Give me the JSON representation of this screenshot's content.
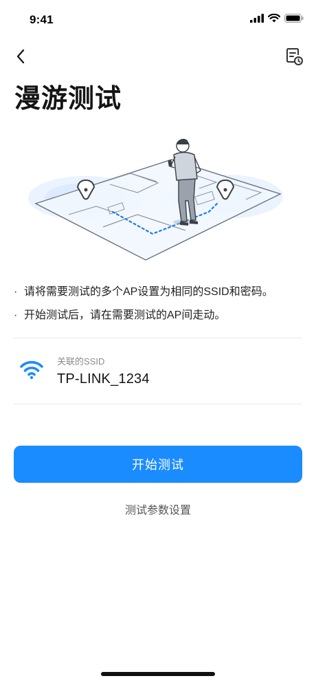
{
  "status_bar": {
    "time": "9:41"
  },
  "nav": {
    "back_icon": "chevron-left-icon",
    "history_icon": "document-clock-icon"
  },
  "page": {
    "title": "漫游测试"
  },
  "tips": [
    {
      "bullet": "·",
      "text": "请将需要测试的多个AP设置为相同的SSID和密码。"
    },
    {
      "bullet": "·",
      "text": "开始测试后，请在需要测试的AP间走动。"
    }
  ],
  "ssid": {
    "label": "关联的SSID",
    "value": "TP-LINK_1234",
    "icon": "wifi-icon"
  },
  "actions": {
    "start_label": "开始测试",
    "settings_label": "测试参数设置"
  },
  "colors": {
    "accent": "#1a8cff",
    "illustration_blue": "#cfe3fb"
  }
}
